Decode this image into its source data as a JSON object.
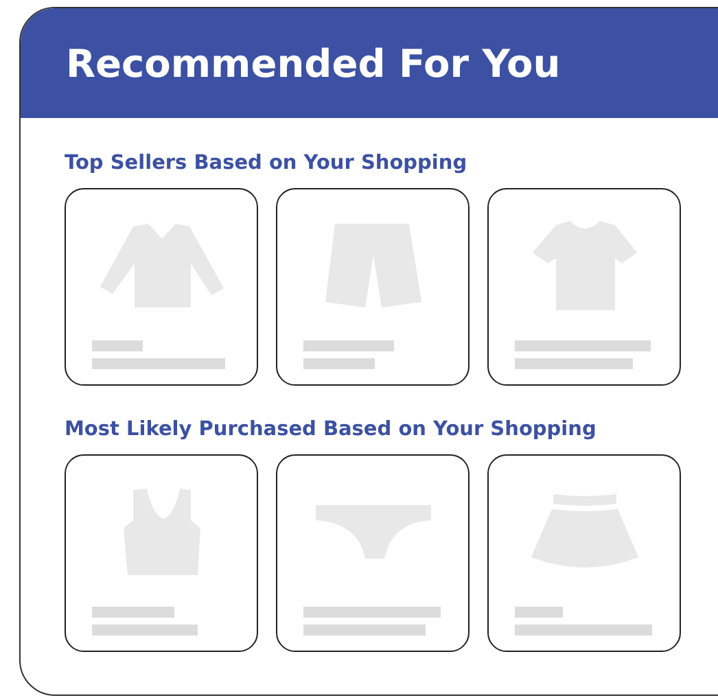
{
  "header": {
    "title": "Recommended For You"
  },
  "sections": [
    {
      "heading": "Top Sellers Based on Your Shopping",
      "products": [
        {
          "kind": "long-sleeve-shirt"
        },
        {
          "kind": "shorts"
        },
        {
          "kind": "t-shirt"
        }
      ]
    },
    {
      "heading": "Most Likely Purchased Based on Your Shopping",
      "products": [
        {
          "kind": "tank-top"
        },
        {
          "kind": "briefs"
        },
        {
          "kind": "skirt"
        }
      ]
    }
  ]
}
